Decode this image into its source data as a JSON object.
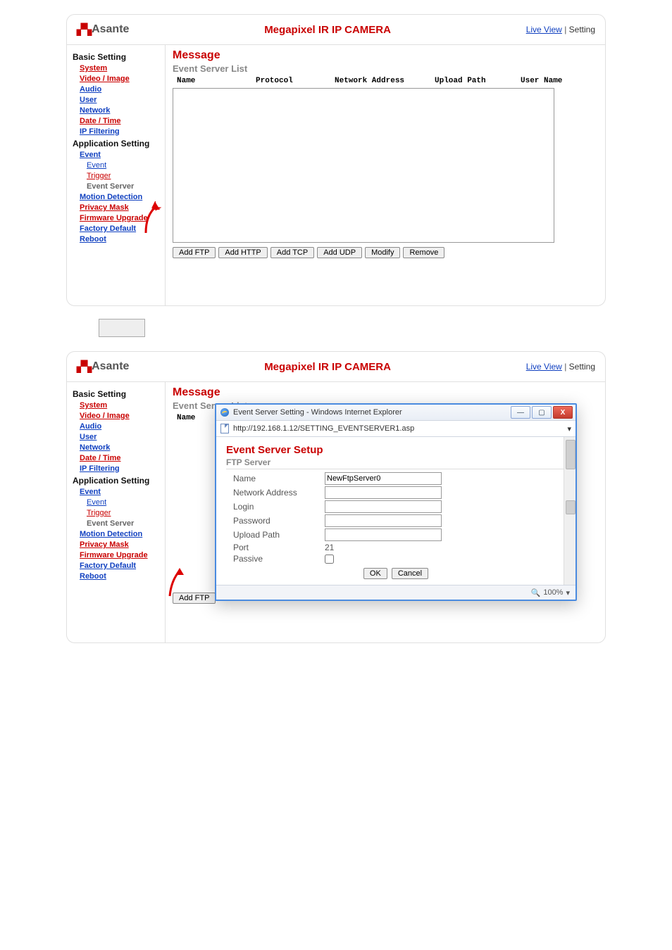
{
  "brand": "Asante",
  "product_title": "Megapixel IR IP CAMERA",
  "header_links": {
    "live_view": "Live View",
    "setting": "Setting"
  },
  "nav": {
    "basic_setting": "Basic Setting",
    "system": "System",
    "video_image": "Video / Image",
    "audio": "Audio",
    "user": "User",
    "network": "Network",
    "date_time": "Date / Time",
    "ip_filtering": "IP Filtering",
    "application_setting": "Application Setting",
    "event": "Event",
    "event_sub": "Event",
    "trigger": "Trigger",
    "event_server": "Event Server",
    "motion_detection": "Motion Detection",
    "privacy_mask": "Privacy Mask",
    "firmware_upgrade": "Firmware Upgrade",
    "factory_default": "Factory Default",
    "reboot": "Reboot"
  },
  "content": {
    "message": "Message",
    "section": "Event Server List",
    "cols": {
      "name": "Name",
      "protocol": "Protocol",
      "network_address": "Network Address",
      "upload_path": "Upload Path",
      "user_name": "User Name"
    },
    "buttons": {
      "add_ftp": "Add FTP",
      "add_http": "Add HTTP",
      "add_tcp": "Add TCP",
      "add_udp": "Add UDP",
      "modify": "Modify",
      "remove": "Remove"
    }
  },
  "popup": {
    "window_title": "Event Server Setting - Windows Internet Explorer",
    "url": "http://192.168.1.12/SETTING_EVENTSERVER1.asp",
    "setup_title": "Event Server Setup",
    "section": "FTP Server",
    "rows": {
      "name": "Name",
      "network_address": "Network Address",
      "login": "Login",
      "password": "Password",
      "upload_path": "Upload Path",
      "port": "Port",
      "passive": "Passive"
    },
    "values": {
      "name": "NewFtpServer0",
      "network_address": "",
      "login": "",
      "password": "",
      "upload_path": "",
      "port": "21",
      "passive": false
    },
    "ok": "OK",
    "cancel": "Cancel",
    "zoom": "100%"
  }
}
